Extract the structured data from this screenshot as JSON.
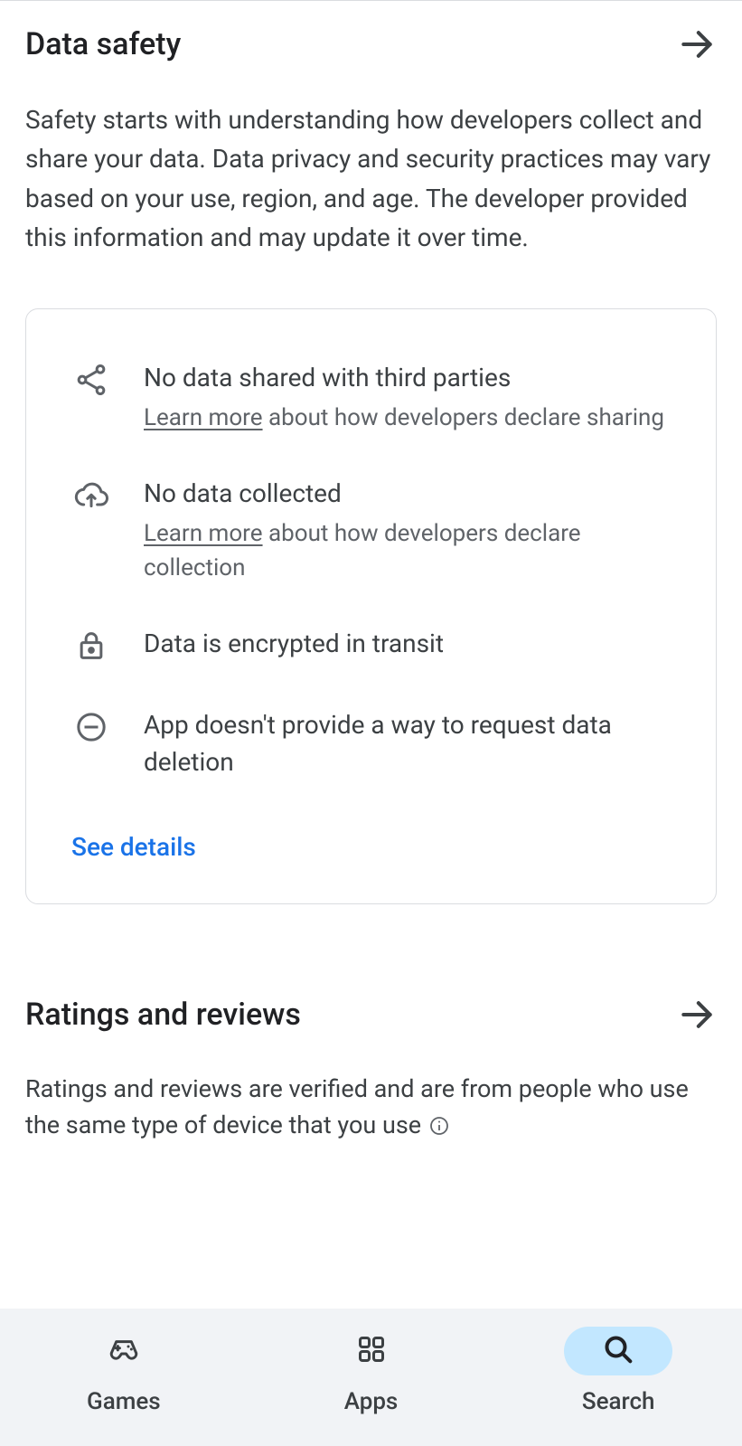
{
  "dataSafety": {
    "title": "Data safety",
    "description": "Safety starts with understanding how developers collect and share your data. Data privacy and security practices may vary based on your use, region, and age. The developer provided this information and may update it over time.",
    "items": [
      {
        "title": "No data shared with third parties",
        "learnMore": "Learn more",
        "subSuffix": " about how developers declare sharing"
      },
      {
        "title": "No data collected",
        "learnMore": "Learn more",
        "subSuffix": " about how developers declare collection"
      },
      {
        "title": "Data is encrypted in transit"
      },
      {
        "title": "App doesn't provide a way to request data deletion"
      }
    ],
    "seeDetails": "See details"
  },
  "ratings": {
    "title": "Ratings and reviews",
    "description": "Ratings and reviews are verified and are from people who use the same type of device that you use "
  },
  "nav": {
    "games": "Games",
    "apps": "Apps",
    "search": "Search"
  }
}
